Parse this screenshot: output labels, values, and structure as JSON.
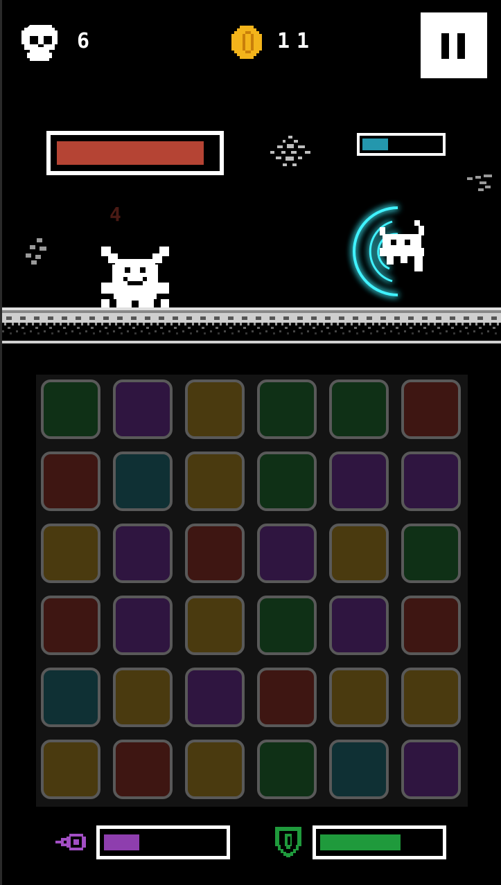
{
  "hud": {
    "kills_icon": "skull-icon",
    "kills": "6",
    "coins_icon": "coin-icon",
    "coins": "11",
    "pause_icon": "pause-icon"
  },
  "battle": {
    "player_health_fraction": 0.94,
    "enemy_charge_fraction": 0.33,
    "damage_popup": "4",
    "colors": {
      "player_health": "#b54434",
      "enemy_charge": "#2497ad",
      "shield_glow": "#3ff2ff"
    }
  },
  "board": {
    "columns": 6,
    "rows": 6,
    "tile_colors": {
      "green": "#0f3016",
      "purple": "#2f1540",
      "yellow": "#4a3a0f",
      "red": "#3e1612",
      "teal": "#0f3034"
    },
    "grid": [
      [
        "green",
        "purple",
        "yellow",
        "green",
        "green",
        "red"
      ],
      [
        "red",
        "teal",
        "yellow",
        "green",
        "purple",
        "purple"
      ],
      [
        "yellow",
        "purple",
        "red",
        "purple",
        "yellow",
        "green"
      ],
      [
        "red",
        "purple",
        "yellow",
        "green",
        "purple",
        "red"
      ],
      [
        "teal",
        "yellow",
        "purple",
        "red",
        "yellow",
        "yellow"
      ],
      [
        "yellow",
        "red",
        "yellow",
        "green",
        "teal",
        "purple"
      ]
    ]
  },
  "bottom": {
    "magic_icon": "magic-eye-icon",
    "magic_fraction": 0.3,
    "magic_color": "#8e3eae",
    "shield_icon": "shield-icon",
    "shield_fraction": 0.68,
    "shield_color": "#1f9a3c"
  }
}
